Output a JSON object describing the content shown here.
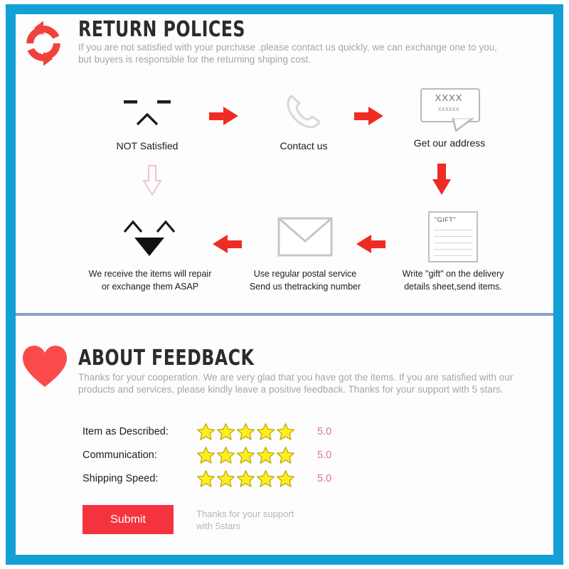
{
  "theme": {
    "border_color": "#12A0D7",
    "accent_red": "#EE2B24",
    "submit_red": "#F5333F",
    "star_fill": "#FCEE21",
    "star_stroke": "#B8A400",
    "score_color": "#e0737f",
    "divider_color": "#8d9dc9",
    "muted_text": "#a6a6a6"
  },
  "return_section": {
    "icon": "return-refresh-icon",
    "title": "RETURN POLICES",
    "subtitle": "If you are not satisfied with your purchase .please contact us quickly, we can exchange one to you,\nbut buyers is responsible for the returning shiping cost."
  },
  "flow": {
    "steps": [
      {
        "id": "not-satisfied",
        "icon": "sad-face-icon",
        "caption": "NOT Satisfied"
      },
      {
        "id": "contact-us",
        "icon": "phone-icon",
        "caption": "Contact us"
      },
      {
        "id": "get-address",
        "icon": "speech-bubble-icon",
        "caption": "Get our address",
        "bubble_line1": "XXXX",
        "bubble_line2": "xxxxxx"
      },
      {
        "id": "write-gift",
        "icon": "document-gift-icon",
        "caption": "Write \"gift\" on the delivery\ndetails sheet,send items.",
        "doc_label": "\"GIFT\""
      },
      {
        "id": "postal-service",
        "icon": "envelope-icon",
        "caption": "Use regular postal service\nSend us thetracking number"
      },
      {
        "id": "we-receive",
        "icon": "happy-face-icon",
        "caption": "We receive the items will repair\nor exchange them ASAP"
      }
    ],
    "connectors": [
      {
        "id": "arrow-1",
        "icon": "arrow-right-icon"
      },
      {
        "id": "arrow-2",
        "icon": "arrow-right-icon"
      },
      {
        "id": "arrow-3",
        "icon": "arrow-down-icon"
      },
      {
        "id": "arrow-4",
        "icon": "arrow-left-icon"
      },
      {
        "id": "arrow-5",
        "icon": "arrow-left-icon"
      },
      {
        "id": "arrow-6",
        "icon": "arrow-down-outline-icon"
      }
    ]
  },
  "feedback_section": {
    "icon": "heart-icon",
    "title": "ABOUT FEEDBACK",
    "subtitle": "Thanks for your cooperation. We are very glad that you have got the items. If you are satisfied with our\nproducts and services, please kindly leave a positive feedback. Thanks for your support with 5 stars.",
    "ratings": [
      {
        "label": "Item as Described:",
        "stars": 5,
        "score": "5.0"
      },
      {
        "label": "Communication:",
        "stars": 5,
        "score": "5.0"
      },
      {
        "label": "Shipping Speed:",
        "stars": 5,
        "score": "5.0"
      }
    ],
    "submit_label": "Submit",
    "submit_note": "Thanks for your support\nwith 5stars"
  }
}
